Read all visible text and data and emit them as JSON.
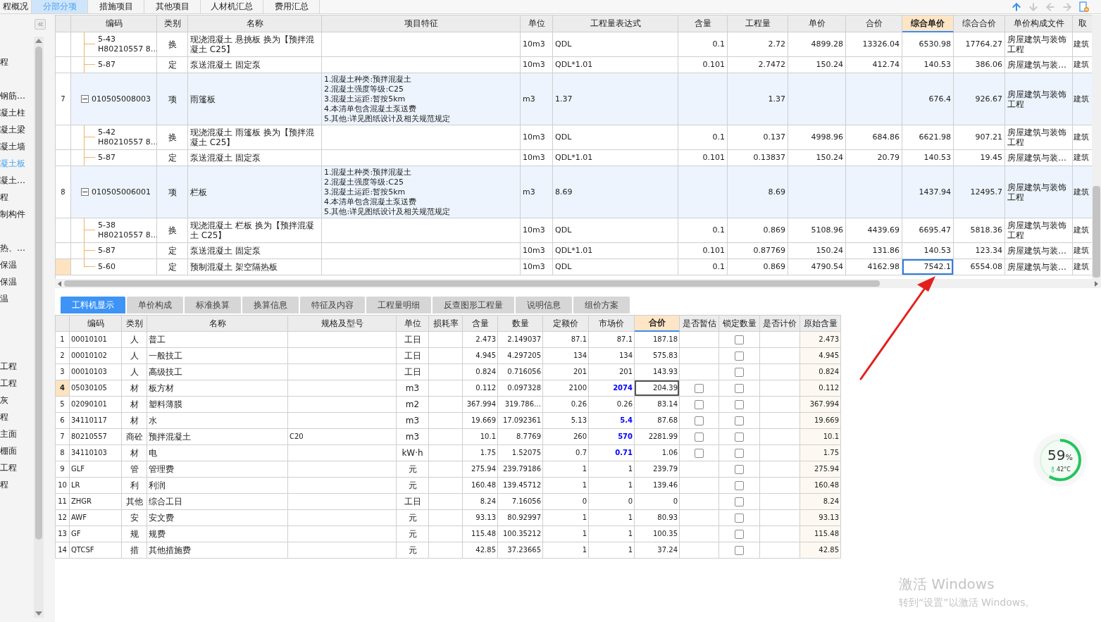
{
  "top_tabs": [
    {
      "label": "程概况",
      "selected": false
    },
    {
      "label": "分部分项",
      "selected": true
    },
    {
      "label": "措施项目",
      "selected": false
    },
    {
      "label": "其他项目",
      "selected": false
    },
    {
      "label": "人材机汇总",
      "selected": false
    },
    {
      "label": "费用汇总",
      "selected": false
    }
  ],
  "sidebar": {
    "items": [
      {
        "kind": "item",
        "label": "程",
        "selected": false
      },
      {
        "kind": "gap"
      },
      {
        "kind": "item",
        "label": "钢筋…",
        "selected": false
      },
      {
        "kind": "item",
        "label": "凝土柱",
        "selected": false
      },
      {
        "kind": "item",
        "label": "凝土梁",
        "selected": false
      },
      {
        "kind": "item",
        "label": "凝土墙",
        "selected": false
      },
      {
        "kind": "item",
        "label": "凝土板",
        "selected": true
      },
      {
        "kind": "item",
        "label": "凝土…",
        "selected": false
      },
      {
        "kind": "item",
        "label": "程",
        "selected": false
      },
      {
        "kind": "item",
        "label": "制构件",
        "selected": false
      },
      {
        "kind": "gap"
      },
      {
        "kind": "item",
        "label": "热、…",
        "selected": false
      },
      {
        "kind": "item",
        "label": "保温",
        "selected": false
      },
      {
        "kind": "item",
        "label": "保温",
        "selected": false
      },
      {
        "kind": "item",
        "label": "温",
        "selected": false
      },
      {
        "kind": "gap"
      },
      {
        "kind": "gap"
      },
      {
        "kind": "gap"
      },
      {
        "kind": "item",
        "label": "工程",
        "selected": false
      },
      {
        "kind": "item",
        "label": "工程",
        "selected": false
      },
      {
        "kind": "item",
        "label": "灰",
        "selected": false
      },
      {
        "kind": "item",
        "label": "程",
        "selected": false
      },
      {
        "kind": "item",
        "label": "主面",
        "selected": false
      },
      {
        "kind": "item",
        "label": "棚面",
        "selected": false
      },
      {
        "kind": "item",
        "label": "工程",
        "selected": false
      },
      {
        "kind": "item",
        "label": "程",
        "selected": false
      }
    ]
  },
  "upper_table": {
    "columns": [
      {
        "label": "编码",
        "highlighted": false
      },
      {
        "label": "类别",
        "highlighted": false
      },
      {
        "label": "名称",
        "highlighted": false
      },
      {
        "label": "项目特征",
        "highlighted": false
      },
      {
        "label": "单位",
        "highlighted": false
      },
      {
        "label": "工程量表达式",
        "highlighted": false
      },
      {
        "label": "含量",
        "highlighted": false
      },
      {
        "label": "工程量",
        "highlighted": false
      },
      {
        "label": "单价",
        "highlighted": false
      },
      {
        "label": "合价",
        "highlighted": false
      },
      {
        "label": "综合单价",
        "highlighted": true
      },
      {
        "label": "综合合价",
        "highlighted": false
      },
      {
        "label": "单价构成文件",
        "highlighted": false
      },
      {
        "label": "取",
        "highlighted": false
      }
    ],
    "rows": [
      {
        "kind": "sub",
        "selected": false,
        "cells": [
          "5-43\nH80210557 8…",
          "换",
          "现浇混凝土 悬挑板  换为【预拌混凝土 C25】",
          null,
          "10m3",
          "QDL",
          "0.1",
          "2.72",
          "4899.28",
          "13326.04",
          "6530.98",
          "17764.27",
          "房屋建筑与装饰工程",
          "建筑"
        ]
      },
      {
        "kind": "sub",
        "selected": false,
        "cells": [
          "5-87",
          "定",
          "泵送混凝土 固定泵",
          null,
          "10m3",
          "QDL*1.01",
          "0.101",
          "2.7472",
          "150.24",
          "412.74",
          "140.53",
          "386.06",
          "房屋建筑与装…",
          "建筑"
        ]
      },
      {
        "kind": "item",
        "selected": false,
        "expanded": true,
        "cells": [
          "010505008003",
          "项",
          "雨篷板",
          "1.混凝土种类:预拌混凝土\n2.混凝土强度等级:C25\n3.混凝土运距:暂按5km\n4.本清单包含混凝土泵送费\n5.其他:详见图纸设计及相关规范规定",
          "m3",
          "1.37",
          null,
          "1.37",
          null,
          null,
          "676.4",
          "926.67",
          "房屋建筑与装饰工程",
          "建筑"
        ],
        "no": "7"
      },
      {
        "kind": "sub",
        "selected": false,
        "cells": [
          "5-42\nH80210557 8…",
          "换",
          "现浇混凝土 雨篷板  换为【预拌混凝土 C25】",
          null,
          "10m3",
          "QDL",
          "0.1",
          "0.137",
          "4998.96",
          "684.86",
          "6621.98",
          "907.21",
          "房屋建筑与装饰工程",
          "建筑"
        ]
      },
      {
        "kind": "sub",
        "selected": false,
        "cells": [
          "5-87",
          "定",
          "泵送混凝土 固定泵",
          null,
          "10m3",
          "QDL*1.01",
          "0.101",
          "0.13837",
          "150.24",
          "20.79",
          "140.53",
          "19.45",
          "房屋建筑与装…",
          "建筑"
        ]
      },
      {
        "kind": "item",
        "selected": false,
        "expanded": true,
        "cells": [
          "010505006001",
          "项",
          "栏板",
          "1.混凝土种类:预拌混凝土\n2.混凝土强度等级:C25\n3.混凝土运距:暂按5km\n4.本清单包含混凝土泵送费\n5.其他:详见图纸设计及相关规范规定",
          "m3",
          "8.69",
          null,
          "8.69",
          null,
          null,
          "1437.94",
          "12495.7",
          "房屋建筑与装饰工程",
          "建筑"
        ],
        "no": "8"
      },
      {
        "kind": "sub",
        "selected": false,
        "cells": [
          "5-38\nH80210557 8…",
          "换",
          "现浇混凝土 栏板  换为【预拌混凝土 C25】",
          null,
          "10m3",
          "QDL",
          "0.1",
          "0.869",
          "5108.96",
          "4439.69",
          "6695.47",
          "5818.36",
          "房屋建筑与装饰工程",
          "建筑"
        ]
      },
      {
        "kind": "sub",
        "selected": false,
        "cells": [
          "5-87",
          "定",
          "泵送混凝土 固定泵",
          null,
          "10m3",
          "QDL*1.01",
          "0.101",
          "0.87769",
          "150.24",
          "131.86",
          "140.53",
          "123.34",
          "房屋建筑与装…",
          "建筑"
        ]
      },
      {
        "kind": "sub",
        "selected": true,
        "cells": [
          "5-60",
          "定",
          "预制混凝土 架空隔热板",
          null,
          "10m3",
          "QDL",
          "0.1",
          "0.869",
          "4790.54",
          "4162.98",
          "7542.1",
          "6554.08",
          "房屋建筑与装…",
          "建筑"
        ]
      }
    ]
  },
  "lower_tabs": [
    {
      "label": "工料机显示",
      "selected": true
    },
    {
      "label": "单价构成",
      "selected": false
    },
    {
      "label": "标准换算",
      "selected": false
    },
    {
      "label": "换算信息",
      "selected": false
    },
    {
      "label": "特征及内容",
      "selected": false
    },
    {
      "label": "工程量明细",
      "selected": false
    },
    {
      "label": "反查图形工程量",
      "selected": false
    },
    {
      "label": "说明信息",
      "selected": false
    },
    {
      "label": "组价方案",
      "selected": false
    }
  ],
  "lower_table": {
    "columns": [
      {
        "label": "编码",
        "highlighted": false
      },
      {
        "label": "类别",
        "highlighted": false
      },
      {
        "label": "名称",
        "highlighted": false
      },
      {
        "label": "规格及型号",
        "highlighted": false
      },
      {
        "label": "单位",
        "highlighted": false
      },
      {
        "label": "损耗率",
        "highlighted": false
      },
      {
        "label": "含量",
        "highlighted": false
      },
      {
        "label": "数量",
        "highlighted": false
      },
      {
        "label": "定额价",
        "highlighted": false
      },
      {
        "label": "市场价",
        "highlighted": false
      },
      {
        "label": "合价",
        "highlighted": true
      },
      {
        "label": "是否暂估",
        "highlighted": false
      },
      {
        "label": "锁定数量",
        "highlighted": false
      },
      {
        "label": "是否计价",
        "highlighted": false
      },
      {
        "label": "原始含量",
        "highlighted": false
      }
    ],
    "rows": [
      {
        "no": "1",
        "selected": false,
        "code": "00010101",
        "type": "人",
        "name": "普工",
        "unit": "工日",
        "content": "2.473",
        "qty": "2.149037",
        "base": "87.1",
        "market": "87.1",
        "market_changed": false,
        "total": "187.18",
        "locked": false,
        "original": "2.473"
      },
      {
        "no": "2",
        "selected": false,
        "code": "00010102",
        "type": "人",
        "name": "一般技工",
        "unit": "工日",
        "content": "4.945",
        "qty": "4.297205",
        "base": "134",
        "market": "134",
        "market_changed": false,
        "total": "575.83",
        "locked": false,
        "original": "4.945"
      },
      {
        "no": "3",
        "selected": false,
        "code": "00010103",
        "type": "人",
        "name": "高级技工",
        "unit": "工日",
        "content": "0.824",
        "qty": "0.716056",
        "base": "201",
        "market": "201",
        "market_changed": false,
        "total": "143.93",
        "locked": false,
        "original": "0.824"
      },
      {
        "no": "4",
        "selected": true,
        "code": "05030105",
        "type": "材",
        "name": "板方材",
        "unit": "m3",
        "content": "0.112",
        "qty": "0.097328",
        "base": "2100",
        "market": "2074",
        "market_changed": true,
        "total": "204.39",
        "tentative": false,
        "locked": false,
        "original": "0.112"
      },
      {
        "no": "5",
        "selected": false,
        "code": "02090101",
        "type": "材",
        "name": "塑料薄膜",
        "unit": "m2",
        "content": "367.994",
        "qty": "319.786…",
        "base": "0.26",
        "market": "0.26",
        "market_changed": false,
        "total": "83.14",
        "tentative": false,
        "locked": false,
        "original": "367.994"
      },
      {
        "no": "6",
        "selected": false,
        "code": "34110117",
        "type": "材",
        "name": "水",
        "unit": "m3",
        "content": "19.669",
        "qty": "17.092361",
        "base": "5.13",
        "market": "5.4",
        "market_changed": true,
        "total": "87.68",
        "tentative": false,
        "locked": false,
        "original": "19.669"
      },
      {
        "no": "7",
        "selected": false,
        "code": "80210557",
        "type": "商砼",
        "name": "预拌混凝土",
        "spec": "C20",
        "unit": "m3",
        "content": "10.1",
        "qty": "8.7769",
        "base": "260",
        "market": "570",
        "market_changed": true,
        "total": "2281.99",
        "tentative": false,
        "locked": false,
        "original": "10.1"
      },
      {
        "no": "8",
        "selected": false,
        "code": "34110103",
        "type": "材",
        "name": "电",
        "unit": "kW·h",
        "content": "1.75",
        "qty": "1.52075",
        "base": "0.7",
        "market": "0.71",
        "market_changed": true,
        "total": "1.06",
        "tentative": false,
        "locked": false,
        "original": "1.75"
      },
      {
        "no": "9",
        "selected": false,
        "code": "GLF",
        "type": "管",
        "name": "管理费",
        "unit": "元",
        "content": "275.94",
        "qty": "239.79186",
        "base": "1",
        "market": "1",
        "market_changed": false,
        "total": "239.79",
        "locked": false,
        "original": "275.94"
      },
      {
        "no": "10",
        "selected": false,
        "code": "LR",
        "type": "利",
        "name": "利润",
        "unit": "元",
        "content": "160.48",
        "qty": "139.45712",
        "base": "1",
        "market": "1",
        "market_changed": false,
        "total": "139.46",
        "locked": false,
        "original": "160.48"
      },
      {
        "no": "11",
        "selected": false,
        "code": "ZHGR",
        "type": "其他",
        "name": "综合工日",
        "unit": "工日",
        "content": "8.24",
        "qty": "7.16056",
        "base": "0",
        "market": "0",
        "market_changed": false,
        "total": "0",
        "locked": false,
        "original": "8.24"
      },
      {
        "no": "12",
        "selected": false,
        "code": "AWF",
        "type": "安",
        "name": "安文费",
        "unit": "元",
        "content": "93.13",
        "qty": "80.92997",
        "base": "1",
        "market": "1",
        "market_changed": false,
        "total": "80.93",
        "locked": false,
        "original": "93.13"
      },
      {
        "no": "13",
        "selected": false,
        "code": "GF",
        "type": "规",
        "name": "规费",
        "unit": "元",
        "content": "115.48",
        "qty": "100.35212",
        "base": "1",
        "market": "1",
        "market_changed": false,
        "total": "100.35",
        "locked": false,
        "original": "115.48"
      },
      {
        "no": "14",
        "selected": false,
        "code": "QTCSF",
        "type": "措",
        "name": "其他措施费",
        "unit": "元",
        "content": "42.85",
        "qty": "37.23665",
        "base": "1",
        "market": "1",
        "market_changed": false,
        "total": "37.24",
        "locked": false,
        "original": "42.85"
      }
    ]
  },
  "monitor": {
    "reading": "59",
    "unit": "%",
    "temperature": "42°C",
    "level": 0.59
  },
  "activation_notice": {
    "title": "激活 Windows",
    "text": "转到“设置”以激活 Windows。"
  }
}
